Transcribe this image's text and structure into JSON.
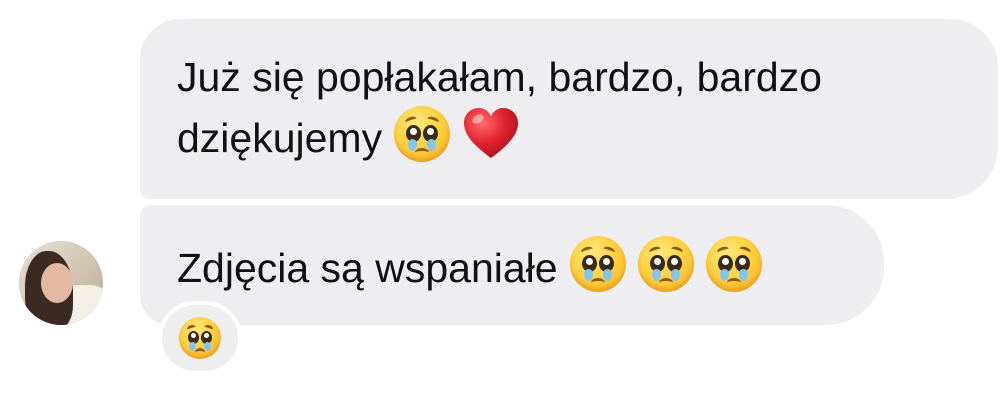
{
  "messages": [
    {
      "lines": [
        "Już się popłakałam, bardzo, bardzo",
        "dziękujemy"
      ],
      "emojis": [
        "pleading-face-icon",
        "red-heart-icon"
      ]
    },
    {
      "text": "Zdjęcia są wspaniałe",
      "emojis": [
        "pleading-face-icon",
        "pleading-face-icon",
        "pleading-face-icon"
      ]
    }
  ],
  "reaction": {
    "emoji": "pleading-face-icon"
  },
  "avatar": {
    "icon": "user-avatar-photo"
  },
  "colors": {
    "bubble": "#eeeef1",
    "text": "#111111",
    "heart": "#e0232e",
    "face": "#ffd23f",
    "tear": "#7fc6f2"
  }
}
